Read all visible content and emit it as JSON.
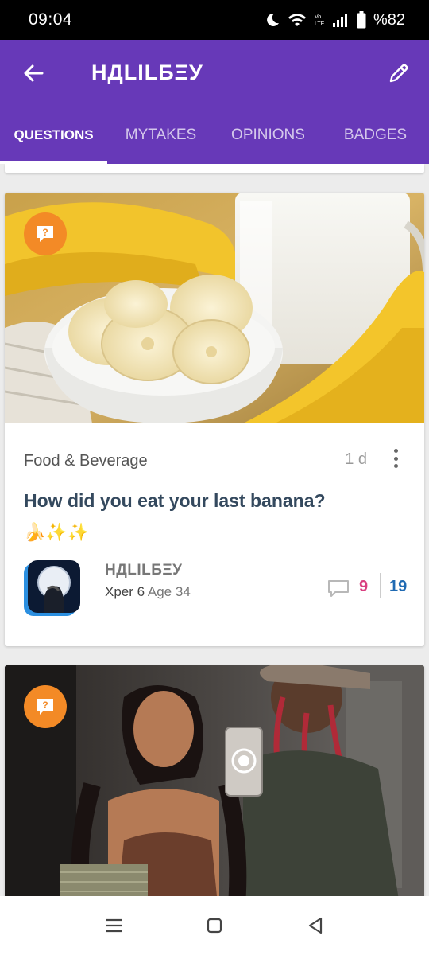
{
  "status_bar": {
    "time": "09:04",
    "battery": "%82",
    "icons": [
      "moon-icon",
      "wifi-icon",
      "volte-icon",
      "signal-icon",
      "battery-icon"
    ]
  },
  "header": {
    "title": "НДLILБΞУ",
    "back_icon": "back-arrow-icon",
    "edit_icon": "pencil-icon",
    "background_color": "#6739b8"
  },
  "tabs": [
    {
      "label": "QUESTIONS",
      "active": true
    },
    {
      "label": "MYTAKES",
      "active": false
    },
    {
      "label": "OPINIONS",
      "active": false
    },
    {
      "label": "BADGES",
      "active": false
    }
  ],
  "cards": [
    {
      "type": "question",
      "badge_icon": "question-bubble-icon",
      "image": "banana-milk-photo",
      "category": "Food & Beverage",
      "time_ago": "1 d",
      "title": "How did you eat your last banana?",
      "emoji": "🍌✨✨",
      "author": {
        "name": "НДLILБΞУ",
        "xper": "Xper 6",
        "age": "Age 34"
      },
      "comments": "9",
      "opinions": "19"
    },
    {
      "type": "question",
      "badge_icon": "question-bubble-icon",
      "image": "couple-selfie-photo"
    }
  ],
  "colors": {
    "accent_orange": "#f38a26",
    "comment_pink": "#d94080",
    "opinion_blue": "#1f6ab3",
    "title_dark": "#34495e"
  },
  "nav_bar": [
    "menu-icon",
    "home-icon",
    "back-icon"
  ]
}
